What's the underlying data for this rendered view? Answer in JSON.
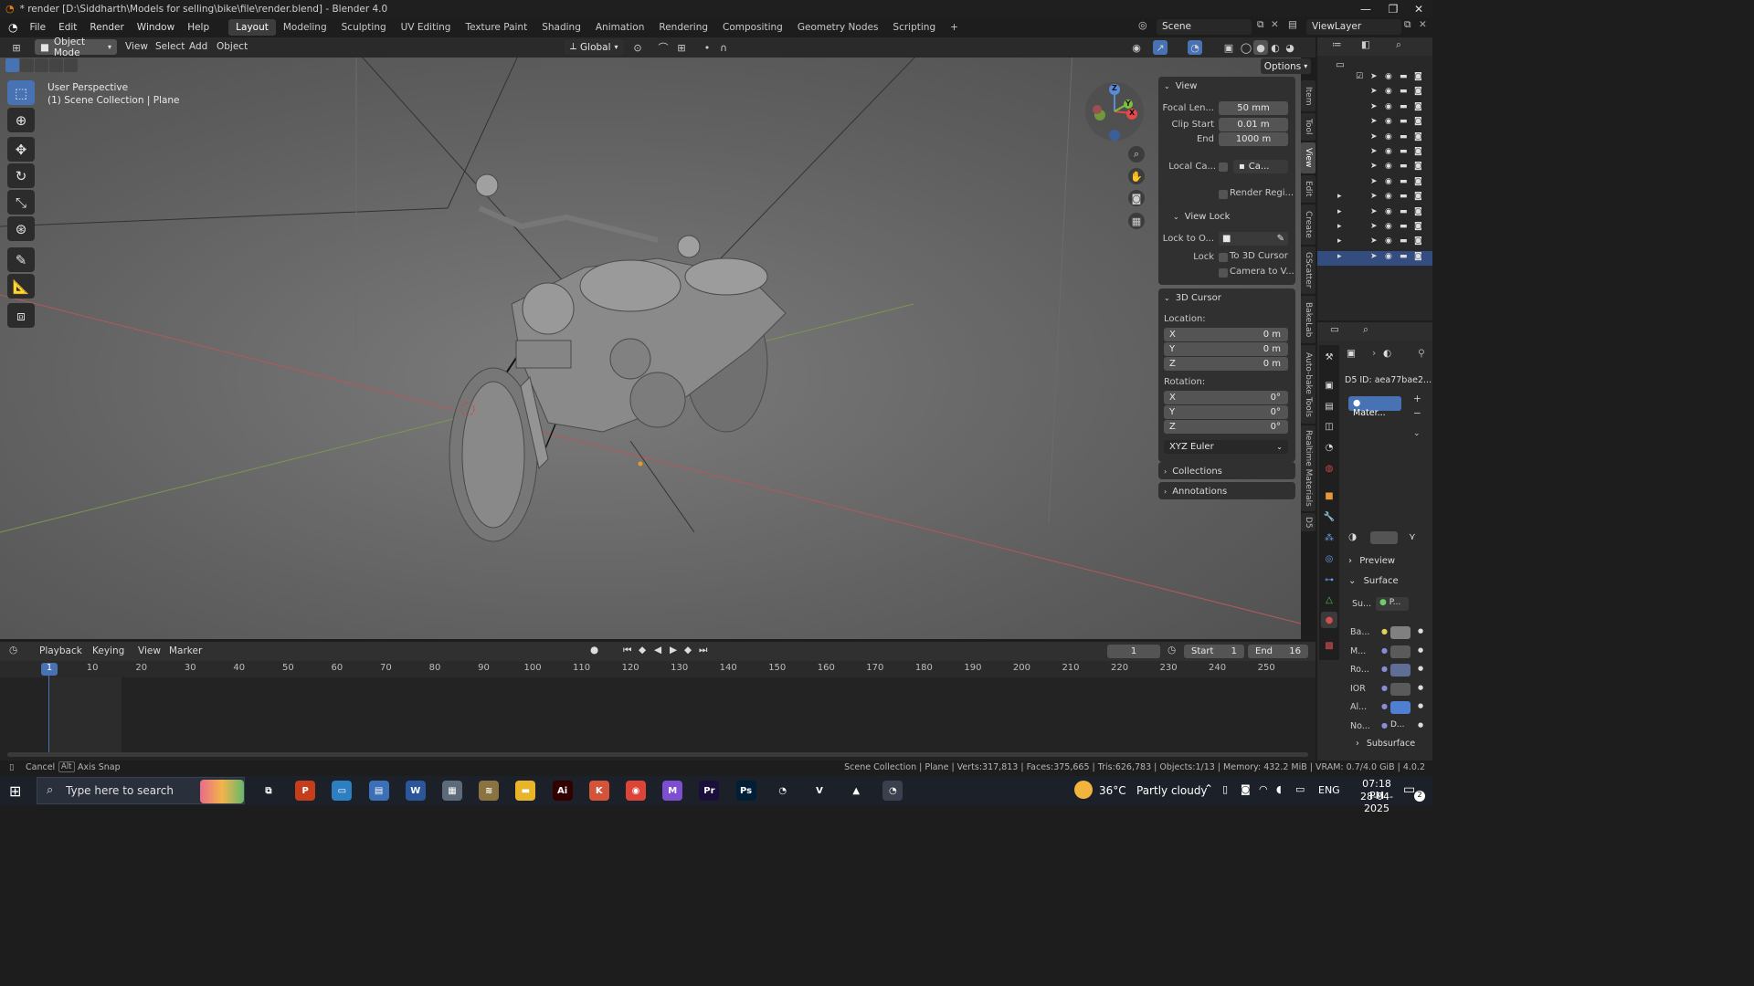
{
  "window": {
    "title": "* render [D:\\Siddharth\\Models for selling\\bike\\file\\render.blend] - Blender 4.0",
    "minimize": "—",
    "restore": "❐",
    "close": "✕"
  },
  "menubar": {
    "items": [
      "File",
      "Edit",
      "Render",
      "Window",
      "Help"
    ],
    "workspaces": [
      "Layout",
      "Modeling",
      "Sculpting",
      "UV Editing",
      "Texture Paint",
      "Shading",
      "Animation",
      "Rendering",
      "Compositing",
      "Geometry Nodes",
      "Scripting"
    ],
    "active_workspace": "Layout",
    "add_tab": "+",
    "scene": "Scene",
    "view_layer": "ViewLayer"
  },
  "viewport_header": {
    "mode": "Object Mode",
    "menus": [
      "View",
      "Select",
      "Add",
      "Object"
    ],
    "orientation": "Global",
    "options": "Options"
  },
  "viewport": {
    "perspective": "User Perspective",
    "collection_info": "(1) Scene Collection | Plane",
    "gizmo": {
      "x": "X",
      "y": "Y",
      "z": "Z"
    }
  },
  "npanel": {
    "view_section": "View",
    "focal_length_label": "Focal Len...",
    "focal_length_value": "50 mm",
    "clip_start_label": "Clip Start",
    "clip_start_value": "0.01 m",
    "clip_end_label": "End",
    "clip_end_value": "1000 m",
    "local_camera_label": "Local Ca...",
    "local_camera_value": "Ca...",
    "render_region_label": "Render Regi...",
    "view_lock_section": "View Lock",
    "lock_to_object_label": "Lock to O...",
    "lock_label": "Lock",
    "lock_to_3d_cursor": "To 3D Cursor",
    "lock_camera_to_view": "Camera to V...",
    "cursor_section": "3D Cursor",
    "location_label": "Location:",
    "loc_x_label": "X",
    "loc_x": "0 m",
    "loc_y_label": "Y",
    "loc_y": "0 m",
    "loc_z_label": "Z",
    "loc_z": "0 m",
    "rotation_label": "Rotation:",
    "rot_x_label": "X",
    "rot_x": "0°",
    "rot_y_label": "Y",
    "rot_y": "0°",
    "rot_z_label": "Z",
    "rot_z": "0°",
    "rotation_mode": "XYZ Euler",
    "collections_section": "Collections",
    "annotations_section": "Annotations"
  },
  "npanel_tabs": [
    "Item",
    "Tool",
    "View",
    "Edit",
    "Create",
    "GScatter",
    "BakeLab",
    "Auto-bake Tools",
    "Realtime Materials",
    "D5"
  ],
  "active_npanel_tab": "View",
  "properties": {
    "d5_id": "D5 ID: aea77bae2...",
    "material_slot": "Mater...",
    "preview": "Preview",
    "surface": "Surface",
    "surface_short": "Su...",
    "surface_value": "P...",
    "inputs": [
      {
        "label": "Ba...",
        "color": "#808080"
      },
      {
        "label": "M...",
        "color": "#5a5a5a"
      },
      {
        "label": "Ro...",
        "color": "#5e6e96"
      },
      {
        "label": "IOR",
        "color": "#5a5a5a"
      },
      {
        "label": "Al...",
        "color": "#4f7fd0"
      },
      {
        "label": "No...",
        "value": "D..."
      }
    ],
    "subsurface": "Subsurface"
  },
  "timeline": {
    "menus": [
      "Playback",
      "Keying",
      "View",
      "Marker"
    ],
    "current_frame": "1",
    "start_label": "Start",
    "start": "1",
    "end_label": "End",
    "end": "16",
    "ruler": [
      "1",
      "10",
      "20",
      "30",
      "40",
      "50",
      "60",
      "70",
      "80",
      "90",
      "100",
      "110",
      "120",
      "130",
      "140",
      "150",
      "160",
      "170",
      "180",
      "190",
      "200",
      "210",
      "220",
      "230",
      "240",
      "250"
    ]
  },
  "statusbar": {
    "cancel": "Cancel",
    "alt_key": "Alt",
    "axis_snap": "Axis Snap",
    "stats": "Scene Collection | Plane | Verts:317,813 | Faces:375,665 | Tris:626,783 | Objects:1/13 | Memory: 432.2 MiB | VRAM: 0.7/4.0 GiB | 4.0.2"
  },
  "taskbar": {
    "search_placeholder": "Type here to search",
    "weather_temp": "36°C",
    "weather_desc": "Partly cloudy",
    "language": "ENG",
    "time": "07:18 PM",
    "date": "28-04-2025",
    "notifications": "2",
    "apps": [
      {
        "name": "task-view",
        "label": "⧉",
        "color": "#1b2029"
      },
      {
        "name": "powerpoint",
        "label": "P",
        "color": "#c43e1c"
      },
      {
        "name": "monitor-app",
        "label": "▭",
        "color": "#2d7fc1"
      },
      {
        "name": "files-app",
        "label": "▤",
        "color": "#3b6fb6"
      },
      {
        "name": "word",
        "label": "W",
        "color": "#2b579a"
      },
      {
        "name": "photos-app",
        "label": "▦",
        "color": "#5c6a7a"
      },
      {
        "name": "stack-app",
        "label": "≋",
        "color": "#8a7340"
      },
      {
        "name": "file-explorer",
        "label": "▬",
        "color": "#e8b42a"
      },
      {
        "name": "illustrator",
        "label": "Ai",
        "color": "#330000"
      },
      {
        "name": "keyshot",
        "label": "K",
        "color": "#d4543a"
      },
      {
        "name": "chrome",
        "label": "◉",
        "color": "#db4437"
      },
      {
        "name": "m365",
        "label": "M",
        "color": "#7b4fd0"
      },
      {
        "name": "premiere",
        "label": "Pr",
        "color": "#1a0f3a"
      },
      {
        "name": "photoshop",
        "label": "Ps",
        "color": "#001e36"
      },
      {
        "name": "blender-a",
        "label": "◔",
        "color": "#1b2029"
      },
      {
        "name": "vectornator",
        "label": "V",
        "color": "#1b2029"
      },
      {
        "name": "vlc",
        "label": "▲",
        "color": "#1b2029"
      },
      {
        "name": "blender-active",
        "label": "◔",
        "color": "#3a404d"
      }
    ]
  }
}
